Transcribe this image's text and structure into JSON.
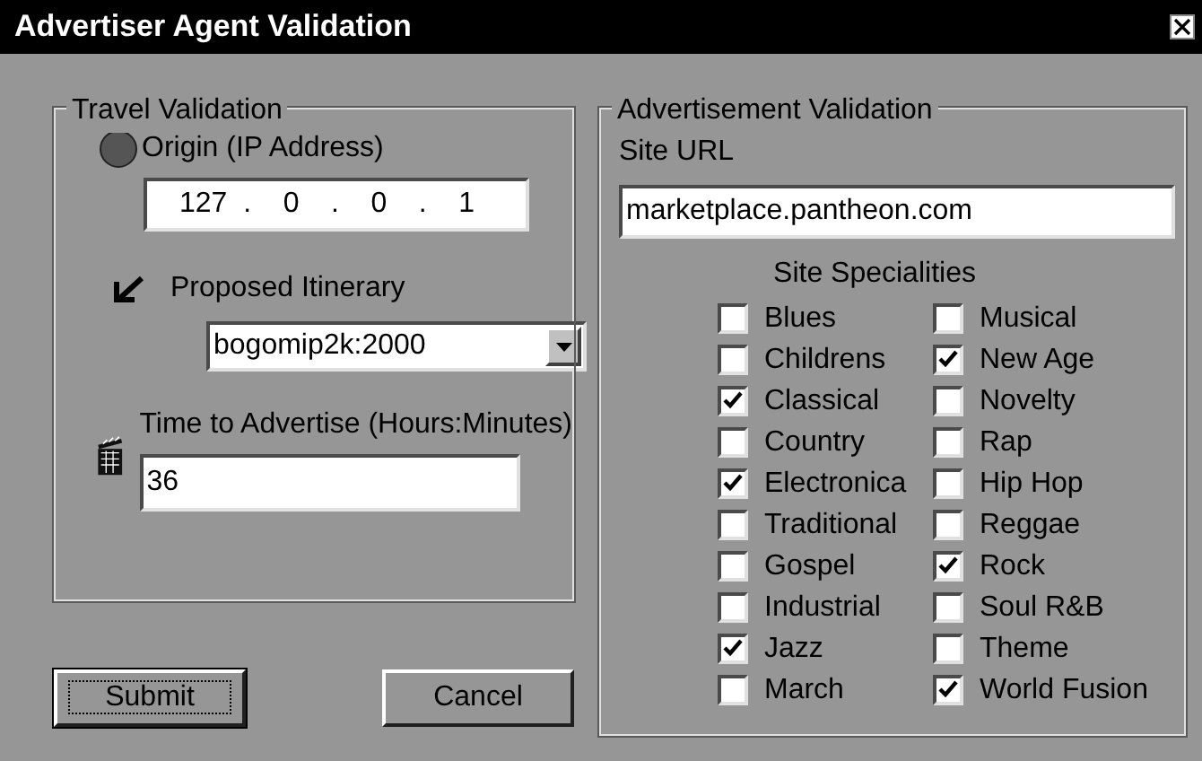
{
  "window": {
    "title": "Advertiser Agent Validation"
  },
  "travel": {
    "title": "Travel Validation",
    "origin_label": "Origin (IP Address)",
    "ip": "127  .    0    .    0    .    1",
    "itinerary_label": "Proposed Itinerary",
    "itinerary_value": "bogomip2k:2000",
    "time_label": "Time to Advertise (Hours:Minutes)",
    "time_value": "36"
  },
  "advertisement": {
    "title": "Advertisement Validation",
    "url_label": "Site URL",
    "url_value": "marketplace.pantheon.com",
    "specialities_title": "Site Specialities",
    "specialities": [
      {
        "label": "Blues",
        "checked": false
      },
      {
        "label": "Musical",
        "checked": false
      },
      {
        "label": "Childrens",
        "checked": false
      },
      {
        "label": "New Age",
        "checked": true
      },
      {
        "label": "Classical",
        "checked": true
      },
      {
        "label": "Novelty",
        "checked": false
      },
      {
        "label": "Country",
        "checked": false
      },
      {
        "label": "Rap",
        "checked": false
      },
      {
        "label": "Electronica",
        "checked": true
      },
      {
        "label": "Hip Hop",
        "checked": false
      },
      {
        "label": "Traditional",
        "checked": false
      },
      {
        "label": "Reggae",
        "checked": false
      },
      {
        "label": "Gospel",
        "checked": false
      },
      {
        "label": "Rock",
        "checked": true
      },
      {
        "label": "Industrial",
        "checked": false
      },
      {
        "label": "Soul R&B",
        "checked": false
      },
      {
        "label": "Jazz",
        "checked": true
      },
      {
        "label": "Theme",
        "checked": false
      },
      {
        "label": "March",
        "checked": false
      },
      {
        "label": "World Fusion",
        "checked": true
      }
    ]
  },
  "buttons": [
    {
      "label": "Submit",
      "focused": true
    },
    {
      "label": "Cancel",
      "focused": false
    }
  ]
}
